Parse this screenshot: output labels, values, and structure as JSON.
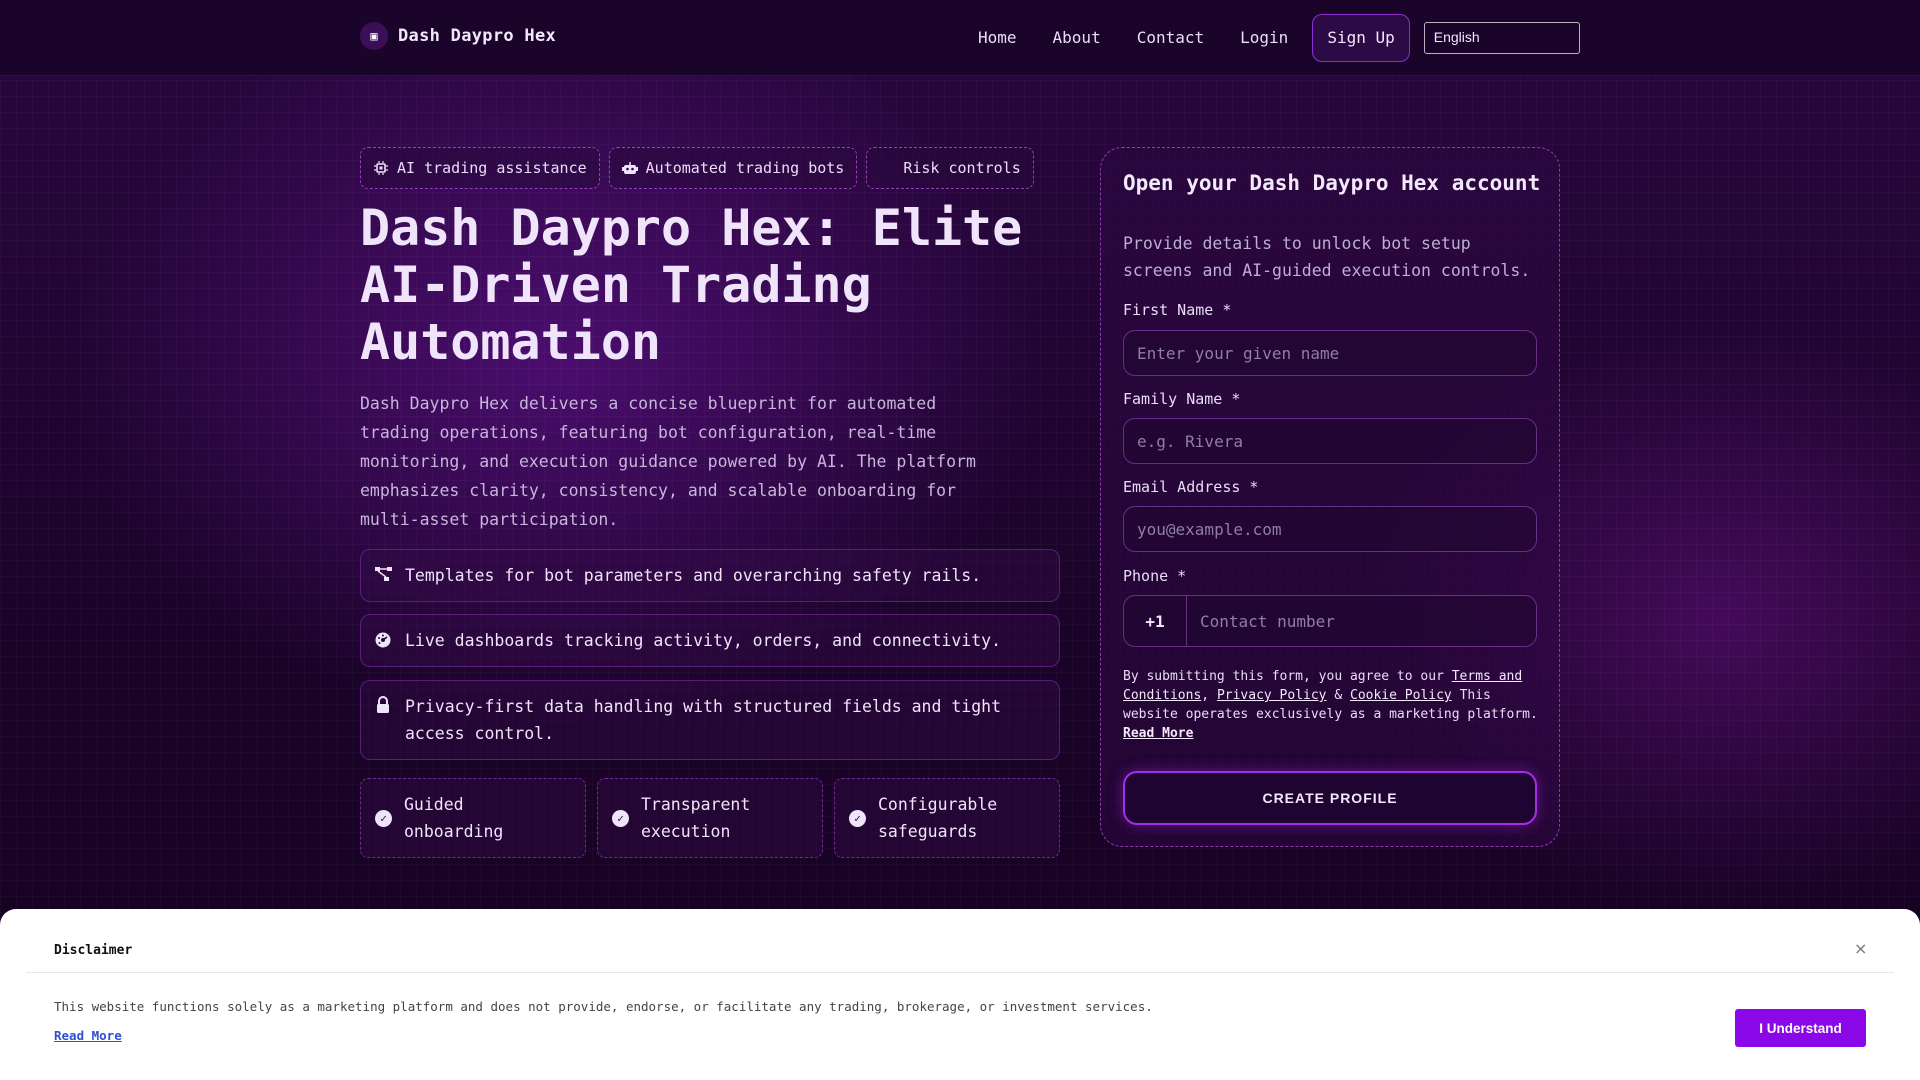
{
  "header": {
    "brand_logo_glyph": "▣",
    "brand_name": "Dash Daypro Hex",
    "nav": [
      "Home",
      "About",
      "Contact",
      "Login"
    ],
    "signup_label": "Sign Up",
    "language": "English"
  },
  "chips": [
    {
      "icon": "chip-icon",
      "label": "AI trading assistance"
    },
    {
      "icon": "robot-icon",
      "label": "Automated trading bots"
    },
    {
      "icon": "none",
      "label": "Risk controls"
    }
  ],
  "hero": {
    "title": "Dash Daypro Hex: Elite AI-Driven Trading Automation",
    "description": "Dash Daypro Hex delivers a concise blueprint for automated trading operations, featuring bot configuration, real-time monitoring, and execution guidance powered by AI. The platform emphasizes clarity, consistency, and scalable onboarding for multi-asset participation."
  },
  "features": [
    {
      "icon": "network-icon",
      "text": "Templates for bot parameters and overarching safety rails."
    },
    {
      "icon": "dashboard-icon",
      "text": "Live dashboards tracking activity, orders, and connectivity."
    },
    {
      "icon": "lock-icon",
      "text": "Privacy-first data handling with structured fields and tight access control."
    }
  ],
  "badges": [
    "Guided onboarding",
    "Transparent execution",
    "Configurable safeguards"
  ],
  "form": {
    "title": "Open your Dash Daypro Hex account",
    "subtitle": "Provide details to unlock bot setup screens and AI-guided execution controls.",
    "first_name_label": "First Name *",
    "first_name_placeholder": "Enter your given name",
    "family_name_label": "Family Name *",
    "family_name_placeholder": "e.g. Rivera",
    "email_label": "Email Address *",
    "email_placeholder": "you@example.com",
    "phone_label": "Phone *",
    "phone_code": "+1",
    "phone_placeholder": "Contact number",
    "legal_prefix": "By submitting this form, you agree to our",
    "terms_link": "Terms and Conditions",
    "privacy_link": "Privacy Policy",
    "amp": "&",
    "cookie_link": "Cookie Policy",
    "legal_suffix": "This website operates exclusively as a marketing platform.",
    "read_more": "Read More",
    "submit_label": "CREATE PROFILE"
  },
  "disclaimer": {
    "title": "Disclaimer",
    "close_glyph": "×",
    "text": "This website functions solely as a marketing platform and does not provide, endorse, or facilitate any trading, brokerage, or investment services.",
    "read_more": "Read More",
    "button": "I Understand"
  },
  "colors": {
    "accent": "#8a08e8",
    "border_purple": "#a62de8",
    "background": "#1a0328"
  }
}
